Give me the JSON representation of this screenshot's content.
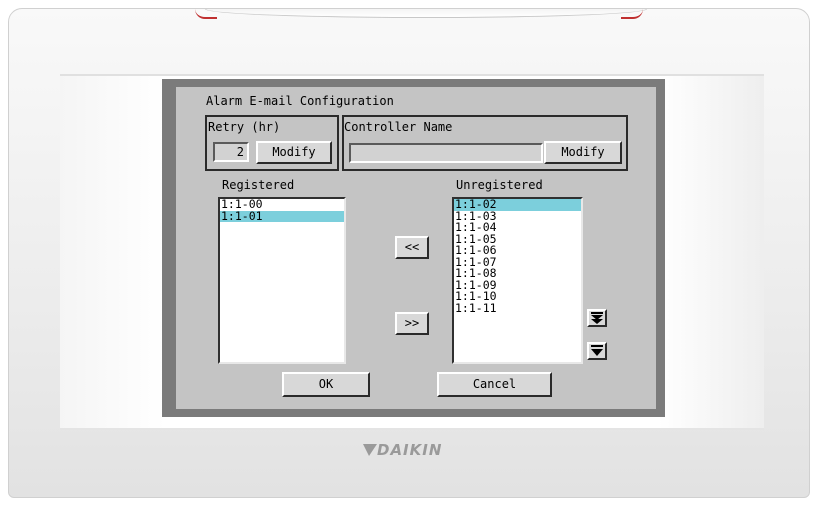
{
  "dialog": {
    "title": "Alarm E-mail Configuration",
    "retry": {
      "label": "Retry (hr)",
      "value": "2",
      "modify_label": "Modify"
    },
    "controller": {
      "label": "Controller Name",
      "value": "",
      "modify_label": "Modify"
    },
    "registered": {
      "label": "Registered",
      "items": [
        "1:1-00",
        "1:1-01"
      ],
      "selected_index": 1
    },
    "unregistered": {
      "label": "Unregistered",
      "items": [
        "1:1-02",
        "1:1-03",
        "1:1-04",
        "1:1-05",
        "1:1-06",
        "1:1-07",
        "1:1-08",
        "1:1-09",
        "1:1-10",
        "1:1-11"
      ],
      "selected_index": 0
    },
    "move_left_label": "<<",
    "move_right_label": ">>",
    "ok_label": "OK",
    "cancel_label": "Cancel"
  },
  "brand": {
    "logo_text": "DAIKIN"
  },
  "icons": {
    "scroll_bottom": "double-down-arrow-icon",
    "scroll_down": "down-arrow-icon"
  },
  "colors": {
    "selection": "#7ccfdc",
    "screen_bg": "#c4c4c4"
  }
}
